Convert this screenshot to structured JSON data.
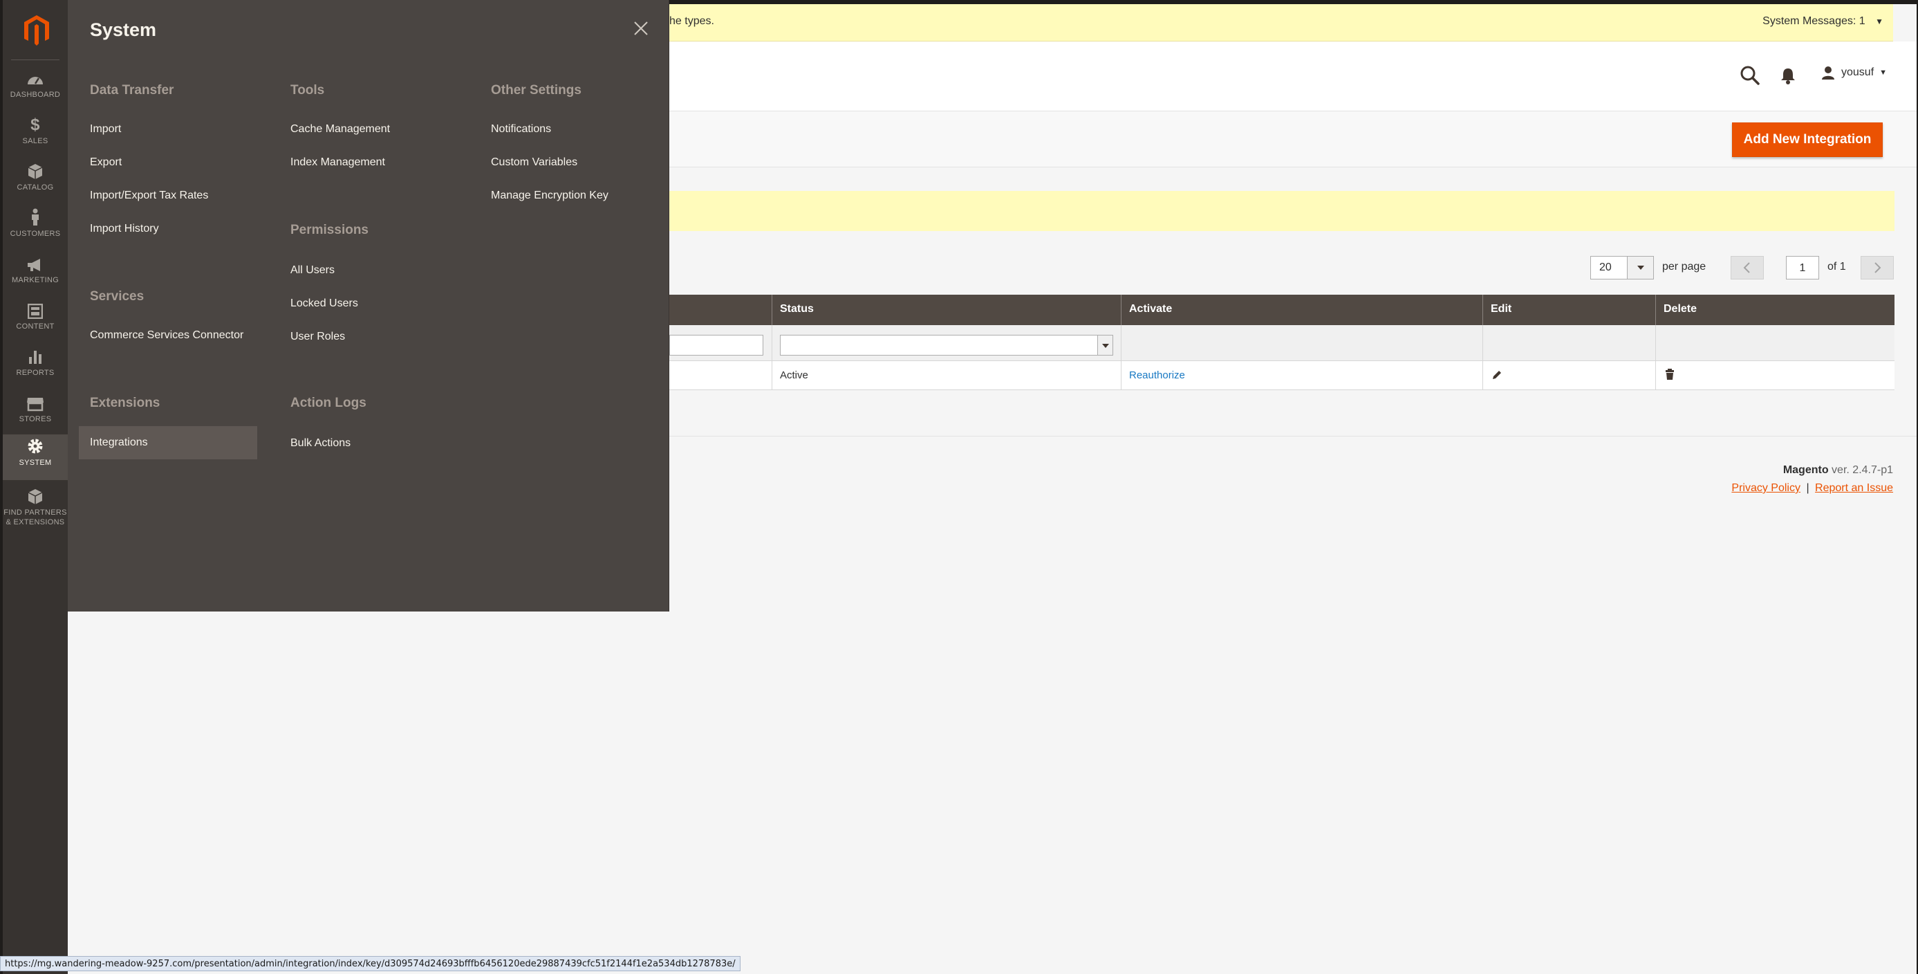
{
  "nav": {
    "items": [
      {
        "label": "Dashboard",
        "icon": "dashboard-icon"
      },
      {
        "label": "Sales",
        "icon": "dollar-icon"
      },
      {
        "label": "Catalog",
        "icon": "catalog-box-icon"
      },
      {
        "label": "Customers",
        "icon": "customer-person-icon"
      },
      {
        "label": "Marketing",
        "icon": "megaphone-icon"
      },
      {
        "label": "Content",
        "icon": "content-layout-icon"
      },
      {
        "label": "Reports",
        "icon": "bar-chart-icon"
      },
      {
        "label": "Stores",
        "icon": "store-icon"
      },
      {
        "label": "System",
        "icon": "gear-icon"
      },
      {
        "label_line1": "Find Partners",
        "label_line2": "& Extensions",
        "icon": "partners-box-icon"
      }
    ]
  },
  "flyout": {
    "title": "System",
    "data_transfer": {
      "title": "Data Transfer",
      "items": [
        "Import",
        "Export",
        "Import/Export Tax Rates",
        "Import History"
      ]
    },
    "services": {
      "title": "Services",
      "items": [
        "Commerce Services Connector"
      ]
    },
    "extensions": {
      "title": "Extensions",
      "items": [
        "Integrations"
      ]
    },
    "tools": {
      "title": "Tools",
      "items": [
        "Cache Management",
        "Index Management"
      ]
    },
    "permissions": {
      "title": "Permissions",
      "items": [
        "All Users",
        "Locked Users",
        "User Roles"
      ]
    },
    "action_logs": {
      "title": "Action Logs",
      "items": [
        "Bulk Actions"
      ]
    },
    "other_settings": {
      "title": "Other Settings",
      "items": [
        "Notifications",
        "Custom Variables",
        "Manage Encryption Key"
      ]
    }
  },
  "sysbar": {
    "message_tail": "he types.",
    "system_messages": "System Messages: 1"
  },
  "header": {
    "user": "yousuf"
  },
  "actions": {
    "add_new": "Add New Integration"
  },
  "pager": {
    "per_page_value": "20",
    "per_page_label": "per page",
    "page": "1",
    "of_label": "of 1"
  },
  "grid": {
    "columns": [
      "Status",
      "Activate",
      "Edit",
      "Delete"
    ],
    "rows": [
      {
        "status": "Active",
        "activate": "Reauthorize"
      }
    ]
  },
  "footer": {
    "brand": "Magento",
    "version": " ver. 2.4.7-p1",
    "privacy": "Privacy Policy",
    "separator": "|",
    "report": "Report an Issue"
  },
  "status_url": "https://mg.wandering-meadow-9257.com/presentation/admin/integration/index/key/d309574d24693bfffb6456120ede29887439cfc51f2144f1e2a534db1278783e/",
  "colors": {
    "accent": "#eb5202",
    "nav_bg": "#373330",
    "flyout_bg": "#4a4542",
    "grid_head": "#514943",
    "notice": "#fffbbb"
  }
}
